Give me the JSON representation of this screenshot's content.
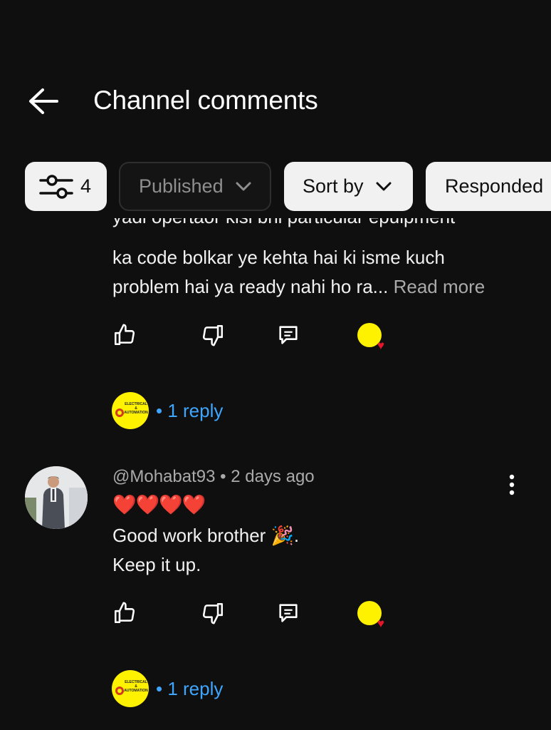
{
  "header": {
    "title": "Channel comments"
  },
  "filters": {
    "filter_count": "4",
    "published": "Published",
    "sort_by": "Sort by",
    "responded": "Responded"
  },
  "comment1": {
    "cut_line": "yadi opertaor kisi bhi particular epuipment",
    "line2": "ka code bolkar ye kehta hai ki isme kuch",
    "line3": "problem hai ya ready nahi ho ra...",
    "read_more": "Read more",
    "replies": "• 1 reply"
  },
  "comment2": {
    "author": "@Mohabat93",
    "time": "• 2 days ago",
    "hearts": "❤️❤️❤️❤️",
    "line1": "Good work brother 🎉.",
    "line2": "Keep it up.",
    "replies": "• 1 reply"
  },
  "channel_logo_text": "ELECTRICAL & AUTOMATION",
  "colors": {
    "background": "#0f0f0f",
    "link": "#3ea6ff",
    "logo": "#fff200",
    "heart": "#e5162b"
  },
  "icons": [
    "back-arrow-icon",
    "filter-sliders-icon",
    "chevron-down-icon",
    "like-icon",
    "dislike-icon",
    "reply-icon",
    "creator-heart-icon",
    "more-vert-icon"
  ]
}
